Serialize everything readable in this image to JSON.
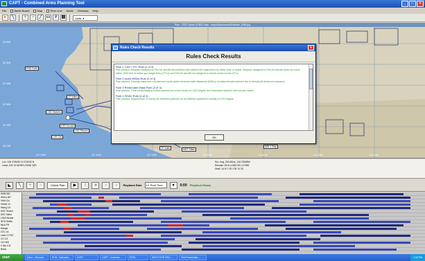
{
  "window": {
    "title": "CAPT - Combined Arms Planning Tool"
  },
  "menu": [
    {
      "label": "File",
      "check": false
    },
    {
      "label": "Battle Board",
      "check": true
    },
    {
      "label": "Map",
      "check": true
    },
    {
      "label": "Time Line",
      "check": true
    },
    {
      "label": "Mode",
      "check": false
    },
    {
      "label": "Overlays",
      "check": false
    },
    {
      "label": "Help",
      "check": false
    }
  ],
  "toolbar": {
    "units_value": "Units: ▾"
  },
  "map": {
    "caption": "Plan : JTEC Demo 070811 Map : Import\\Spectrum\\UPlanline_2060.jpg",
    "lat_labels": [
      "33 00N",
      "32 50N",
      "32 40N",
      "32 30N",
      "32 20N",
      "32 10N"
    ],
    "lon_labels": [
      "117 20W",
      "117 10W",
      "117 00W",
      "116 50W",
      "116 40W",
      "116 30W",
      "116 20W"
    ],
    "tags": [
      "PSD Forth",
      "CP Allied",
      "LSD Tankers",
      "LSS Turnout",
      "LSS Tiburon",
      "LSS Crit",
      "TF Suits",
      "DMT Stitch",
      "IMS 1 Stop"
    ]
  },
  "dialog": {
    "title": "Rules Check Results",
    "heading": "Rules Check Results",
    "rules": [
      {
        "title": "Rule 1 CAS / STL Rule (1 of 3)",
        "text": "Plan passed. Airspace assigned to FAC/AI aircraft deconflicted with indirect fire trajectories by either time or space. Airspace assigned to FAC/AI aircraft does not come within 1000 feet of active gun-target lines (GTLs) and FAC/AI aircraft not assigned to transit active mortar GTLs."
      },
      {
        "title": "Rule 2 Avoid MSDs Rule (2 of 3)",
        "text": "Plan passed. Friendly maneuver not planned inside active minimum safe distances (MSDs) of active threats indexed the or friendly all delivered ordnance."
      },
      {
        "title": "Rule 3 Redundant Mass Rule (3 of 3)",
        "text": "Plan passed. Time consolidations entries planned at correct times on CAS targets and redundant systems will execute marks."
      },
      {
        "title": "Rule 4 SEAD Rule (4 of 4)",
        "text": "Plan passed. Suppression of enemy air defenses planned on air defense systems in vicinity of CAS targets."
      }
    ],
    "ok_label": "OK"
  },
  "info": {
    "left_lines": [
      "Loc: 116 47W/32 N 47W/32 N",
      "Lead: 115 13 MGRS ZONE 33S"
    ],
    "right_lines": [
      "Src: Img, 2014GHz, 116 22W8W",
      "Elevate: 94 N LOAD 59 LG78W",
      "Dest: 14 N 7 00 178 74 23"
    ]
  },
  "timeline_toolbar": {
    "check_plan_label": "Check Plan",
    "playback_rate_label": "Playback Rate",
    "rate_value": "1X Real Time",
    "time_value": "0:00",
    "status": "Playback Ready"
  },
  "timeline": {
    "lanes": [
      "HMM 361",
      "HMLA 367",
      "VMA 214",
      "VMAQ 13",
      "Hiking 1/4",
      "DSS Tiburon",
      "DSS Talbut",
      "LSDS Broker",
      "WTS Sheila",
      "Mk-8 FR",
      "Ranger",
      "CS1 1/4",
      "Lead 13 TSC",
      "CO 1/4",
      "1/4 H&S",
      "C Bty 1/11",
      "Bravo"
    ]
  },
  "taskbar": {
    "start_label": "start",
    "tasks": [
      "Inbox - Microsof...",
      "ECB - Instructio...",
      "CAPT",
      "CAPT - Combine...",
      "PDFs",
      "INPUT FOR DEV...",
      "Text Presentatio..."
    ],
    "clock": "4:33 PM"
  }
}
